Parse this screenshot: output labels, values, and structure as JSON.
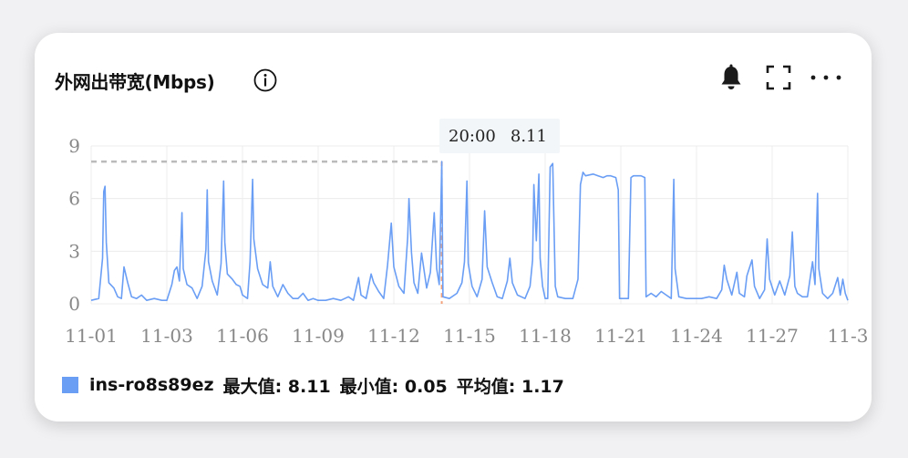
{
  "header": {
    "title": "外网出带宽(Mbps)",
    "info_icon": "info-icon",
    "bell_icon": "bell-icon",
    "fullscreen_icon": "fullscreen-icon",
    "more_icon": "more-icon"
  },
  "tooltip": {
    "time": "20:00",
    "value": "8.11"
  },
  "legend": {
    "series_name": "ins-ro8s89ez",
    "max_label": "最大值: 8.11",
    "min_label": "最小值: 0.05",
    "avg_label": "平均值: 1.17"
  },
  "colors": {
    "series": "#6a9ef5",
    "grid": "#ececec",
    "max_line": "#bbbbbb",
    "cursor": "#f3a17a"
  },
  "chart_data": {
    "type": "line",
    "title": "外网出带宽(Mbps)",
    "xlabel": "",
    "ylabel": "",
    "ylim": [
      0,
      9
    ],
    "yticks": [
      0,
      3,
      6,
      9
    ],
    "x_range_days": [
      0,
      30
    ],
    "xticks": [
      {
        "day": 0,
        "label": "11-01"
      },
      {
        "day": 3,
        "label": "11-03"
      },
      {
        "day": 6,
        "label": "11-06"
      },
      {
        "day": 9,
        "label": "11-09"
      },
      {
        "day": 12,
        "label": "11-12"
      },
      {
        "day": 15,
        "label": "11-15"
      },
      {
        "day": 18,
        "label": "11-18"
      },
      {
        "day": 21,
        "label": "11-21"
      },
      {
        "day": 24,
        "label": "11-24"
      },
      {
        "day": 27,
        "label": "11-27"
      },
      {
        "day": 30,
        "label": "11-3"
      }
    ],
    "grid": true,
    "max_marker": 8.11,
    "highlight_day": 13.9,
    "series": [
      {
        "name": "ins-ro8s89ez",
        "points": [
          [
            0.0,
            0.2
          ],
          [
            0.3,
            0.3
          ],
          [
            0.45,
            2.6
          ],
          [
            0.5,
            6.4
          ],
          [
            0.55,
            6.7
          ],
          [
            0.6,
            3.5
          ],
          [
            0.7,
            1.2
          ],
          [
            0.9,
            0.9
          ],
          [
            1.05,
            0.4
          ],
          [
            1.2,
            0.3
          ],
          [
            1.3,
            2.1
          ],
          [
            1.45,
            1.2
          ],
          [
            1.6,
            0.4
          ],
          [
            1.8,
            0.3
          ],
          [
            2.0,
            0.5
          ],
          [
            2.2,
            0.2
          ],
          [
            2.5,
            0.3
          ],
          [
            2.8,
            0.2
          ],
          [
            3.0,
            0.2
          ],
          [
            3.2,
            1.1
          ],
          [
            3.3,
            1.9
          ],
          [
            3.4,
            2.1
          ],
          [
            3.5,
            1.3
          ],
          [
            3.6,
            5.2
          ],
          [
            3.65,
            2.0
          ],
          [
            3.8,
            1.1
          ],
          [
            4.0,
            0.9
          ],
          [
            4.2,
            0.3
          ],
          [
            4.4,
            1.0
          ],
          [
            4.55,
            3.1
          ],
          [
            4.6,
            6.5
          ],
          [
            4.65,
            2.4
          ],
          [
            4.8,
            1.3
          ],
          [
            5.0,
            0.5
          ],
          [
            5.15,
            2.3
          ],
          [
            5.25,
            7.0
          ],
          [
            5.3,
            3.5
          ],
          [
            5.4,
            1.7
          ],
          [
            5.6,
            1.4
          ],
          [
            5.75,
            1.1
          ],
          [
            5.9,
            1.0
          ],
          [
            6.0,
            0.5
          ],
          [
            6.2,
            0.3
          ],
          [
            6.3,
            2.4
          ],
          [
            6.4,
            7.1
          ],
          [
            6.45,
            3.7
          ],
          [
            6.6,
            2.0
          ],
          [
            6.8,
            1.1
          ],
          [
            7.0,
            0.9
          ],
          [
            7.1,
            2.4
          ],
          [
            7.2,
            1.0
          ],
          [
            7.4,
            0.4
          ],
          [
            7.6,
            1.1
          ],
          [
            7.8,
            0.6
          ],
          [
            8.0,
            0.3
          ],
          [
            8.2,
            0.3
          ],
          [
            8.4,
            0.6
          ],
          [
            8.6,
            0.2
          ],
          [
            8.8,
            0.3
          ],
          [
            9.0,
            0.2
          ],
          [
            9.3,
            0.2
          ],
          [
            9.6,
            0.3
          ],
          [
            9.9,
            0.2
          ],
          [
            10.2,
            0.4
          ],
          [
            10.4,
            0.2
          ],
          [
            10.6,
            1.5
          ],
          [
            10.7,
            0.5
          ],
          [
            10.9,
            0.3
          ],
          [
            11.1,
            1.7
          ],
          [
            11.2,
            1.2
          ],
          [
            11.4,
            0.7
          ],
          [
            11.6,
            0.3
          ],
          [
            11.75,
            2.2
          ],
          [
            11.9,
            4.6
          ],
          [
            12.0,
            2.1
          ],
          [
            12.2,
            1.0
          ],
          [
            12.4,
            0.6
          ],
          [
            12.55,
            3.8
          ],
          [
            12.6,
            6.0
          ],
          [
            12.7,
            2.9
          ],
          [
            12.8,
            1.2
          ],
          [
            12.95,
            0.6
          ],
          [
            13.1,
            2.9
          ],
          [
            13.2,
            1.9
          ],
          [
            13.3,
            0.9
          ],
          [
            13.45,
            1.8
          ],
          [
            13.6,
            5.2
          ],
          [
            13.7,
            2.0
          ],
          [
            13.8,
            1.1
          ],
          [
            13.9,
            8.11
          ],
          [
            13.95,
            0.4
          ],
          [
            14.2,
            0.3
          ],
          [
            14.5,
            0.6
          ],
          [
            14.7,
            1.2
          ],
          [
            14.8,
            2.4
          ],
          [
            14.9,
            7.0
          ],
          [
            14.95,
            2.3
          ],
          [
            15.1,
            1.0
          ],
          [
            15.3,
            0.4
          ],
          [
            15.5,
            1.4
          ],
          [
            15.6,
            5.3
          ],
          [
            15.7,
            2.1
          ],
          [
            15.9,
            1.2
          ],
          [
            16.1,
            0.4
          ],
          [
            16.3,
            0.3
          ],
          [
            16.5,
            1.3
          ],
          [
            16.6,
            2.6
          ],
          [
            16.7,
            1.2
          ],
          [
            16.9,
            0.5
          ],
          [
            17.2,
            0.3
          ],
          [
            17.4,
            1.0
          ],
          [
            17.5,
            2.5
          ],
          [
            17.55,
            6.8
          ],
          [
            17.65,
            3.6
          ],
          [
            17.75,
            7.4
          ],
          [
            17.8,
            2.6
          ],
          [
            17.9,
            1.0
          ],
          [
            18.0,
            0.3
          ],
          [
            18.1,
            0.3
          ],
          [
            18.2,
            7.8
          ],
          [
            18.3,
            8.0
          ],
          [
            18.4,
            1.0
          ],
          [
            18.5,
            0.4
          ],
          [
            18.8,
            0.3
          ],
          [
            19.1,
            0.3
          ],
          [
            19.3,
            1.4
          ],
          [
            19.4,
            6.8
          ],
          [
            19.5,
            7.5
          ],
          [
            19.6,
            7.3
          ],
          [
            19.9,
            7.4
          ],
          [
            20.1,
            7.3
          ],
          [
            20.3,
            7.2
          ],
          [
            20.45,
            7.3
          ],
          [
            20.6,
            7.3
          ],
          [
            20.8,
            7.2
          ],
          [
            20.9,
            6.5
          ],
          [
            20.95,
            0.3
          ],
          [
            21.1,
            0.3
          ],
          [
            21.3,
            0.3
          ],
          [
            21.4,
            7.2
          ],
          [
            21.5,
            7.3
          ],
          [
            21.8,
            7.3
          ],
          [
            21.95,
            7.2
          ],
          [
            22.0,
            0.4
          ],
          [
            22.2,
            0.6
          ],
          [
            22.4,
            0.4
          ],
          [
            22.6,
            0.7
          ],
          [
            22.8,
            0.5
          ],
          [
            23.0,
            0.3
          ],
          [
            23.1,
            7.1
          ],
          [
            23.15,
            2.0
          ],
          [
            23.3,
            0.4
          ],
          [
            23.6,
            0.3
          ],
          [
            23.9,
            0.3
          ],
          [
            24.2,
            0.3
          ],
          [
            24.5,
            0.4
          ],
          [
            24.8,
            0.3
          ],
          [
            25.0,
            0.8
          ],
          [
            25.1,
            2.2
          ],
          [
            25.2,
            1.4
          ],
          [
            25.4,
            0.5
          ],
          [
            25.6,
            1.8
          ],
          [
            25.7,
            0.6
          ],
          [
            25.9,
            0.4
          ],
          [
            26.0,
            1.6
          ],
          [
            26.2,
            2.5
          ],
          [
            26.3,
            1.0
          ],
          [
            26.5,
            0.3
          ],
          [
            26.7,
            0.8
          ],
          [
            26.8,
            3.7
          ],
          [
            26.9,
            1.4
          ],
          [
            27.1,
            0.5
          ],
          [
            27.3,
            1.3
          ],
          [
            27.5,
            0.5
          ],
          [
            27.7,
            1.6
          ],
          [
            27.8,
            4.1
          ],
          [
            27.9,
            1.0
          ],
          [
            28.0,
            0.6
          ],
          [
            28.2,
            0.4
          ],
          [
            28.4,
            0.4
          ],
          [
            28.6,
            2.4
          ],
          [
            28.7,
            1.1
          ],
          [
            28.8,
            6.3
          ],
          [
            28.85,
            2.0
          ],
          [
            29.0,
            0.6
          ],
          [
            29.2,
            0.3
          ],
          [
            29.4,
            0.6
          ],
          [
            29.6,
            1.5
          ],
          [
            29.7,
            0.5
          ],
          [
            29.8,
            1.4
          ],
          [
            29.9,
            0.6
          ],
          [
            30.0,
            0.2
          ]
        ]
      }
    ]
  }
}
